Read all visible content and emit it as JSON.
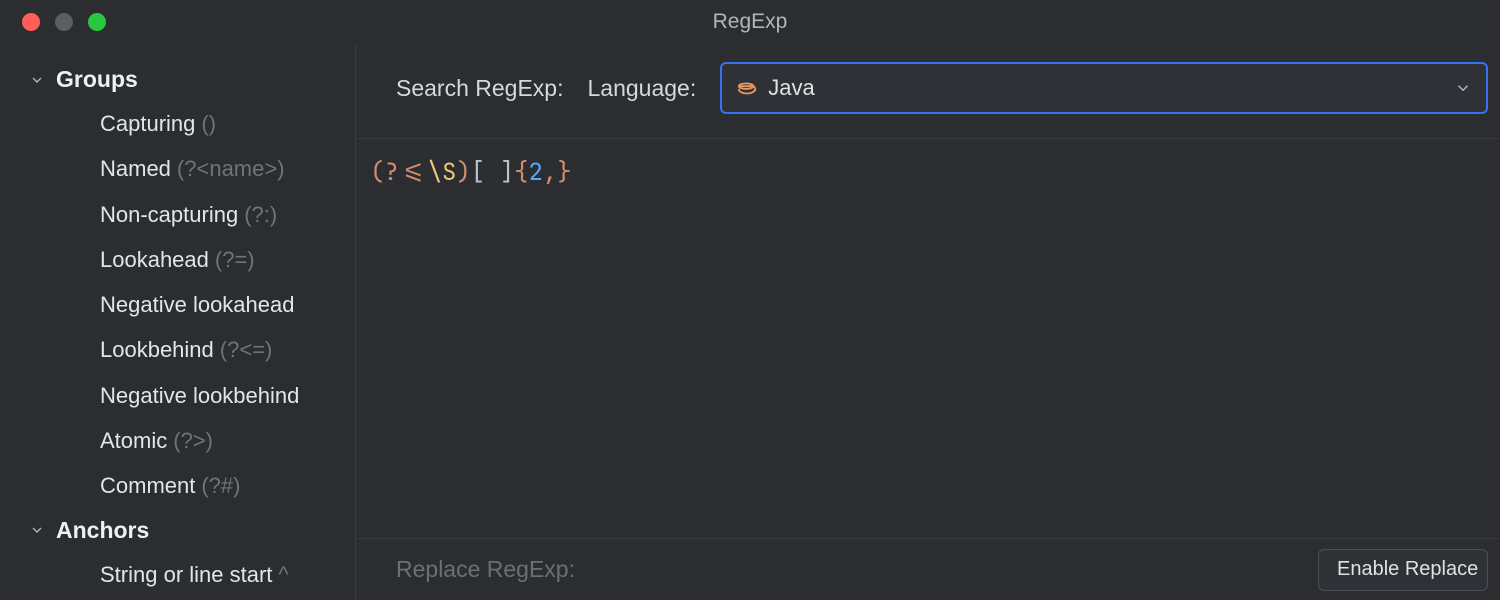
{
  "window": {
    "title": "RegExp"
  },
  "sidebar": {
    "sections": [
      {
        "title": "Groups",
        "items": [
          {
            "label": "Capturing",
            "syntax": "()"
          },
          {
            "label": "Named",
            "syntax": "(?<name>)"
          },
          {
            "label": "Non-capturing",
            "syntax": "(?:)"
          },
          {
            "label": "Lookahead",
            "syntax": "(?=)"
          },
          {
            "label": "Negative lookahead",
            "syntax": ""
          },
          {
            "label": "Lookbehind",
            "syntax": "(?<=)"
          },
          {
            "label": "Negative lookbehind",
            "syntax": ""
          },
          {
            "label": "Atomic",
            "syntax": "(?>)"
          },
          {
            "label": "Comment",
            "syntax": "(?#)"
          }
        ]
      },
      {
        "title": "Anchors",
        "items": [
          {
            "label": "String or line start",
            "syntax": "^"
          }
        ]
      }
    ]
  },
  "toolbar": {
    "search_label": "Search RegExp:",
    "language_label": "Language:",
    "language_value": "Java"
  },
  "editor": {
    "regex_tokens": [
      {
        "t": "(",
        "c": "orange"
      },
      {
        "t": "?<=",
        "c": "orange"
      },
      {
        "t": "\\S",
        "c": "yellow"
      },
      {
        "t": ")",
        "c": "orange"
      },
      {
        "t": "[ ]",
        "c": "plain"
      },
      {
        "t": "{",
        "c": "orange"
      },
      {
        "t": "2",
        "c": "num"
      },
      {
        "t": ",",
        "c": "comma"
      },
      {
        "t": "}",
        "c": "orange"
      }
    ]
  },
  "footer": {
    "replace_label": "Replace RegExp:",
    "enable_replace_label": "Enable Replace"
  }
}
